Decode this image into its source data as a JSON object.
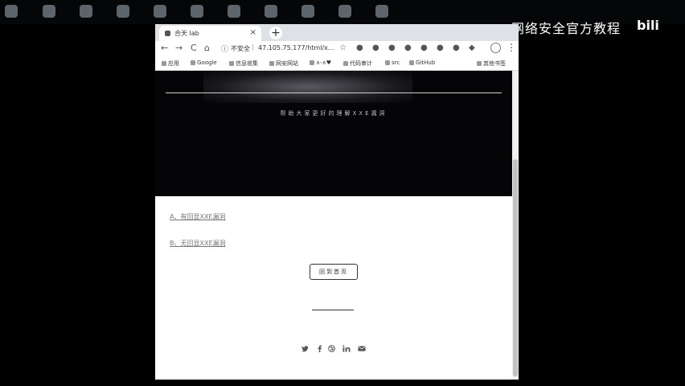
{
  "overlay": {
    "channel_title": "网络安全官方教程",
    "watermark": "bilibili"
  },
  "taskbar": {
    "icons": [
      "app-icon-1",
      "app-icon-2",
      "app-icon-3",
      "app-icon-4",
      "app-icon-5",
      "app-icon-6",
      "app-icon-7",
      "app-icon-8",
      "app-icon-9",
      "app-icon-10",
      "app-icon-11"
    ]
  },
  "browser": {
    "tab": {
      "title": "合天 lab",
      "close": "×"
    },
    "newtab": "+",
    "nav": {
      "back": "←",
      "forward": "→",
      "reload": "C",
      "home": "⌂"
    },
    "omnibox": {
      "info": "ⓘ",
      "security": "不安全",
      "separator": "|",
      "url": "47.105.75.177/html/x..."
    },
    "bookmarks": [
      {
        "label": "应用"
      },
      {
        "label": "Google"
      },
      {
        "label": "信息收集"
      },
      {
        "label": "网安网站"
      },
      {
        "label": "∧-∧♥"
      },
      {
        "label": "代码审计"
      },
      {
        "label": "src"
      },
      {
        "label": "GitHub"
      },
      {
        "label": "其他书签"
      }
    ]
  },
  "page": {
    "subtitle": "帮助大家更好的理解XXE漏洞",
    "link_a": "A、有回显XXE漏洞",
    "link_b": "B、无回显XXE漏洞",
    "home_button": "回到首页",
    "social_icons": [
      "twitter-icon",
      "facebook-icon",
      "dribbble-icon",
      "linkedin-icon",
      "email-icon"
    ]
  }
}
